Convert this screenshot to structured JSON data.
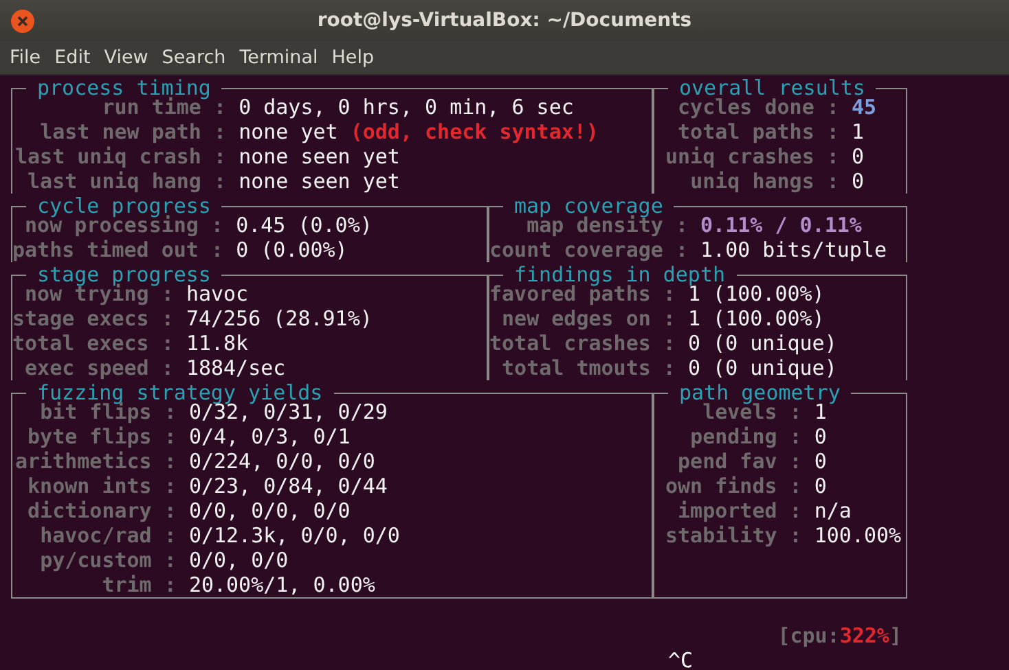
{
  "window": {
    "title": "root@lys-VirtualBox: ~/Documents"
  },
  "menu": [
    "File",
    "Edit",
    "View",
    "Search",
    "Terminal",
    "Help"
  ],
  "panels": [
    {
      "title": "process timing",
      "rows": [
        {
          "label": "run time :",
          "value": "0 days, 0 hrs, 0 min, 6 sec",
          "kind": "plain"
        },
        {
          "label": "last new path :",
          "value": "none yet",
          "kind": "plain",
          "note": "(odd, check syntax!)"
        },
        {
          "label": "last uniq crash :",
          "value": "none seen yet",
          "kind": "plain"
        },
        {
          "label": "last uniq hang :",
          "value": "none seen yet",
          "kind": "plain"
        }
      ]
    },
    {
      "title": "overall results",
      "rows": [
        {
          "label": "cycles done :",
          "value": "45",
          "kind": "cycle"
        },
        {
          "label": "total paths :",
          "value": "1",
          "kind": "plain"
        },
        {
          "label": "uniq crashes :",
          "value": "0",
          "kind": "plain"
        },
        {
          "label": "uniq hangs :",
          "value": "0",
          "kind": "plain"
        }
      ]
    },
    {
      "title": "cycle progress",
      "rows": [
        {
          "label": "now processing :",
          "value": "0.45 (0.0%)",
          "kind": "plain"
        },
        {
          "label": "paths timed out :",
          "value": "0 (0.00%)",
          "kind": "plain"
        }
      ]
    },
    {
      "title": "map coverage",
      "rows": [
        {
          "label": "map density :",
          "value": "0.11% / 0.11%",
          "kind": "density"
        },
        {
          "label": "count coverage :",
          "value": "1.00 bits/tuple",
          "kind": "plain"
        }
      ]
    },
    {
      "title": "stage progress",
      "rows": [
        {
          "label": "now trying :",
          "value": "havoc",
          "kind": "plain"
        },
        {
          "label": "stage execs :",
          "value": "74/256 (28.91%)",
          "kind": "plain"
        },
        {
          "label": "total execs :",
          "value": "11.8k",
          "kind": "plain"
        },
        {
          "label": "exec speed :",
          "value": "1884/sec",
          "kind": "plain"
        }
      ]
    },
    {
      "title": "findings in depth",
      "rows": [
        {
          "label": "favored paths :",
          "value": "1 (100.00%)",
          "kind": "plain"
        },
        {
          "label": "new edges on :",
          "value": "1 (100.00%)",
          "kind": "plain"
        },
        {
          "label": "total crashes :",
          "value": "0 (0 unique)",
          "kind": "plain"
        },
        {
          "label": "total tmouts :",
          "value": "0 (0 unique)",
          "kind": "plain"
        }
      ]
    },
    {
      "title": "fuzzing strategy yields",
      "rows": [
        {
          "label": "bit flips :",
          "value": "0/32, 0/31, 0/29",
          "kind": "plain"
        },
        {
          "label": "byte flips :",
          "value": "0/4, 0/3, 0/1",
          "kind": "plain"
        },
        {
          "label": "arithmetics :",
          "value": "0/224, 0/0, 0/0",
          "kind": "plain"
        },
        {
          "label": "known ints :",
          "value": "0/23, 0/84, 0/44",
          "kind": "plain"
        },
        {
          "label": "dictionary :",
          "value": "0/0, 0/0, 0/0",
          "kind": "plain"
        },
        {
          "label": "havoc/rad :",
          "value": "0/12.3k, 0/0, 0/0",
          "kind": "plain"
        },
        {
          "label": "py/custom :",
          "value": "0/0, 0/0",
          "kind": "plain"
        },
        {
          "label": "trim :",
          "value": "20.00%/1, 0.00%",
          "kind": "plain"
        }
      ]
    },
    {
      "title": "path geometry",
      "rows": [
        {
          "label": "levels :",
          "value": "1",
          "kind": "plain"
        },
        {
          "label": "pending :",
          "value": "0",
          "kind": "plain"
        },
        {
          "label": "pend fav :",
          "value": "0",
          "kind": "plain"
        },
        {
          "label": "own finds :",
          "value": "0",
          "kind": "plain"
        },
        {
          "label": "imported :",
          "value": "n/a",
          "kind": "plain"
        },
        {
          "label": "stability :",
          "value": "100.00%",
          "kind": "plain"
        }
      ]
    }
  ],
  "cpu": {
    "prefix": "[cpu:",
    "value": "322%",
    "suffix": "]"
  },
  "prompt": "^C"
}
